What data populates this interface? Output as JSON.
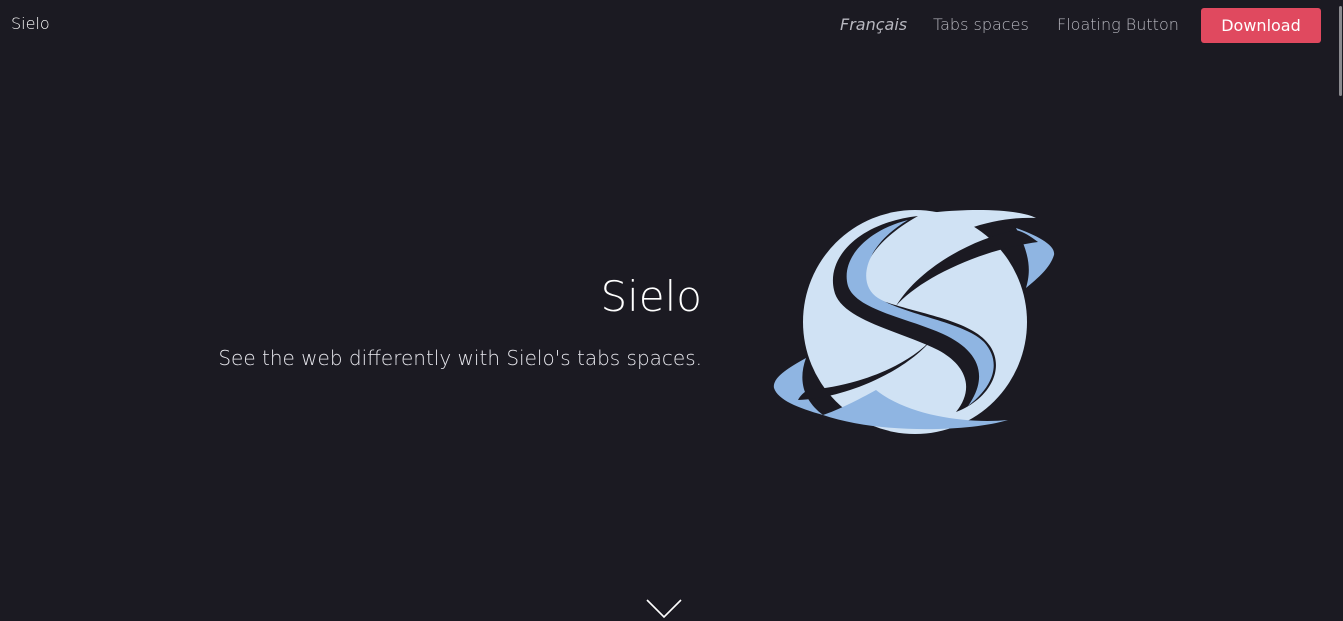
{
  "navbar": {
    "brand": "Sielo",
    "links": [
      {
        "label": "Français"
      },
      {
        "label": "Tabs spaces"
      },
      {
        "label": "Floating Button"
      }
    ],
    "download_label": "Download"
  },
  "hero": {
    "title": "Sielo",
    "subtitle": "See the web differently with Sielo's tabs spaces."
  },
  "icons": {
    "logo": "sielo-logo",
    "scroll_down": "chevron-down-icon"
  },
  "colors": {
    "background": "#1b1a22",
    "accent": "#e0495f",
    "logo_light": "#d0e2f4",
    "logo_mid": "#8fb5e2"
  }
}
